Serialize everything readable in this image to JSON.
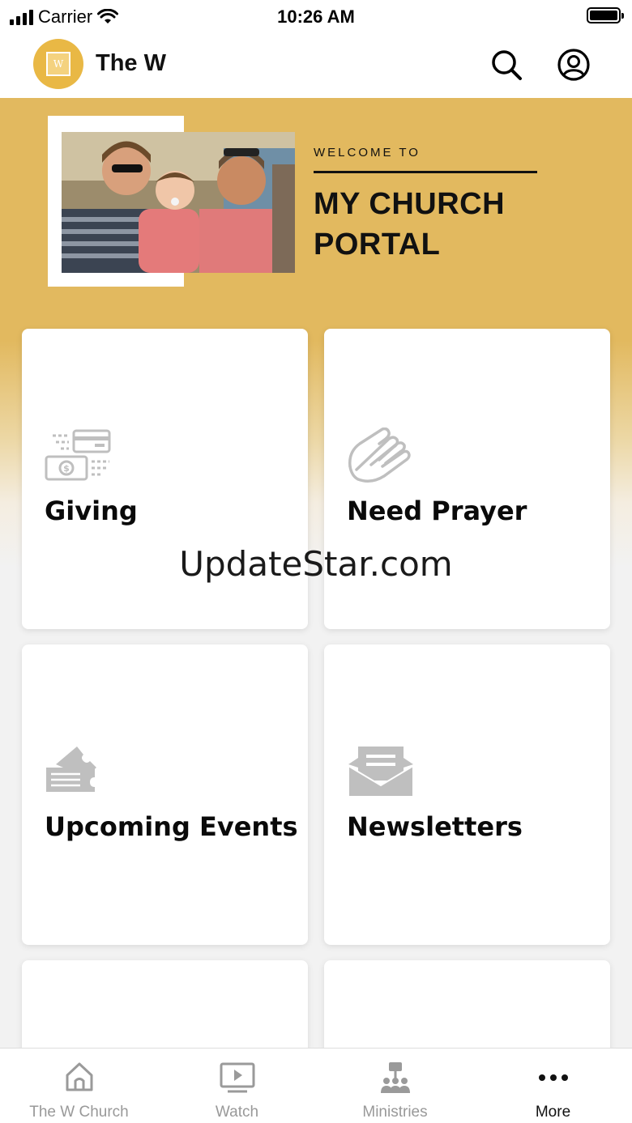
{
  "status_bar": {
    "carrier": "Carrier",
    "time": "10:26 AM"
  },
  "header": {
    "logo_text": "W",
    "title": "The W"
  },
  "hero": {
    "welcome": "WELCOME TO",
    "title_line1": "MY CHURCH",
    "title_line2": "PORTAL"
  },
  "cards": [
    {
      "label": "Giving",
      "icon": "giving-money-card-icon"
    },
    {
      "label": "Need Prayer",
      "icon": "praying-hands-icon"
    },
    {
      "label": "Upcoming Events",
      "icon": "tickets-icon"
    },
    {
      "label": "Newsletters",
      "icon": "envelope-open-icon"
    }
  ],
  "watermark": "UpdateStar.com",
  "tabs": [
    {
      "label": "The W Church",
      "icon": "home-icon",
      "active": false
    },
    {
      "label": "Watch",
      "icon": "play-screen-icon",
      "active": false
    },
    {
      "label": "Ministries",
      "icon": "org-chart-icon",
      "active": false
    },
    {
      "label": "More",
      "icon": "more-dots-icon",
      "active": true
    }
  ],
  "colors": {
    "accent": "#e2b95f",
    "logo": "#e9b845",
    "icon_gray": "#bfbfbf",
    "tab_inactive": "#999999"
  }
}
